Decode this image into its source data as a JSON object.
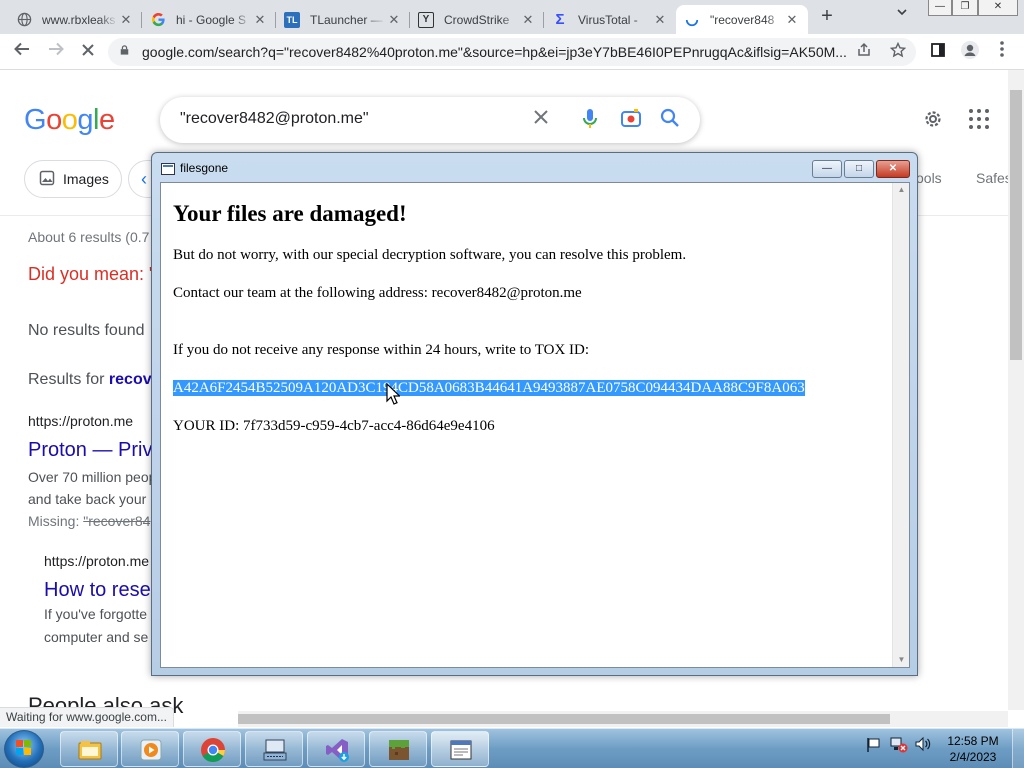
{
  "tabs": [
    {
      "title": "www.rbxleaks",
      "favicon": "globe-icon"
    },
    {
      "title": "hi - Google S",
      "favicon": "google-icon"
    },
    {
      "title": "TLauncher —",
      "favicon": "tlauncher-icon",
      "badge": "TL"
    },
    {
      "title": "CrowdStrike",
      "favicon": "crowdstrike-icon",
      "badge": "Y"
    },
    {
      "title": "VirusTotal -",
      "favicon": "virustotal-icon",
      "badge": "Σ"
    },
    {
      "title": "\"recover848",
      "favicon": "loading-icon",
      "active": true
    }
  ],
  "tab_close_glyph": "✕",
  "new_tab_glyph": "+",
  "address": {
    "url": "google.com/search?q=\"recover8482%40proton.me\"&source=hp&ei=jp3eY7bBE46I0PEPnrugqAc&iflsig=AK50M..."
  },
  "google": {
    "logo_letters": [
      {
        "ch": "G",
        "color": "#4285F4"
      },
      {
        "ch": "o",
        "color": "#EA4335"
      },
      {
        "ch": "o",
        "color": "#FBBC05"
      },
      {
        "ch": "g",
        "color": "#4285F4"
      },
      {
        "ch": "l",
        "color": "#34A853"
      },
      {
        "ch": "e",
        "color": "#EA4335"
      }
    ],
    "search_query": "\"recover8482@proton.me\"",
    "chips": {
      "images": "Images",
      "tools": "ools",
      "safesearch": "Safes"
    },
    "results_count": "About 6 results (0.7",
    "did_you_mean": "Did you mean: \"",
    "no_results": "No results found",
    "results_for_prefix": "Results for ",
    "results_for_term": "recov",
    "result1_url": "https://proton.me",
    "result1_title": "Proton — Priva",
    "result1_snippet1": "Over 70 million peop",
    "result1_snippet2": "and take back your",
    "result1_missing": "Missing: ",
    "result1_missing_term": "\"recover84",
    "result2_url": "https://proton.me",
    "result2_title": "How to rese",
    "result2_snippet1": "If you've forgotte",
    "result2_snippet2": "computer and se",
    "people_also_ask": "People also ask"
  },
  "status_text": "Waiting for www.google.com...",
  "dialog": {
    "title": "filesgone",
    "heading": "Your files are damaged!",
    "line1": "But do not worry, with our special decryption software, you can resolve this problem.",
    "line2": "Contact our team at the following address: recover8482@proton.me",
    "line3": "If you do not receive any response within 24 hours, write to TOX ID:",
    "tox_id": "A42A6F2454B52509A120AD3C194CD58A0683B44641A9493887AE0758C094434DAA88C9F8A063",
    "your_id": "YOUR ID: 7f733d59-c959-4cb7-acc4-86d64e9e4106"
  },
  "taskbar": {
    "apps": [
      "explorer-icon",
      "media-player-icon",
      "chrome-icon",
      "keyboard-app-icon",
      "visual-studio-icon",
      "minecraft-icon",
      "filesgone-window-icon"
    ],
    "time": "12:58 PM",
    "date": "2/4/2023"
  }
}
